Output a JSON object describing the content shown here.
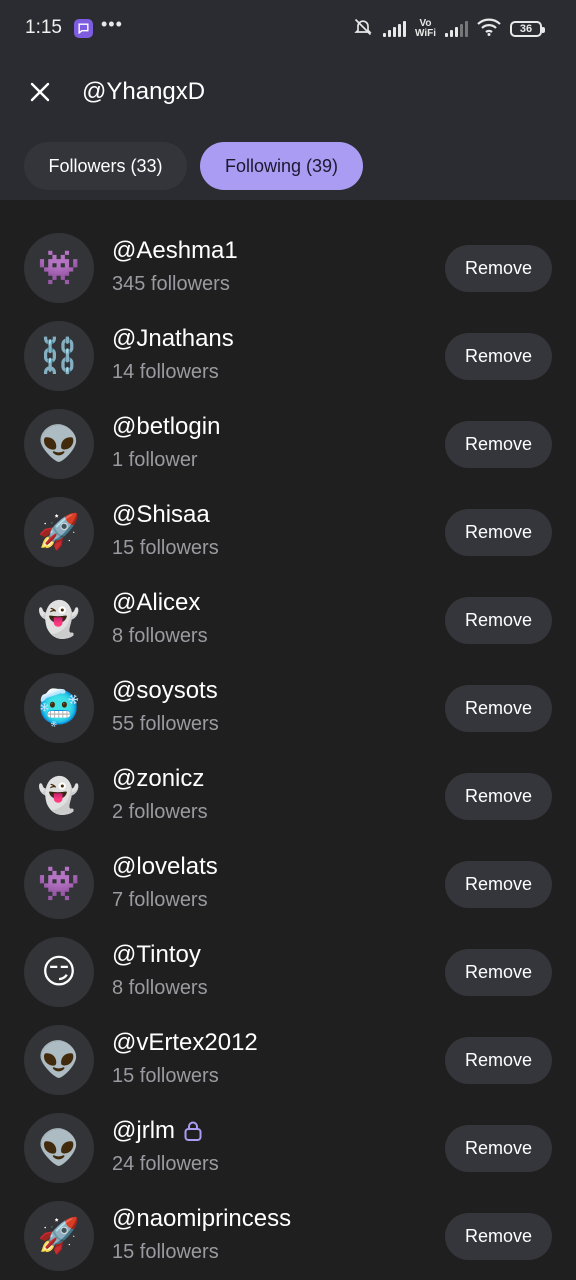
{
  "status_bar": {
    "time": "1:15",
    "battery": "36",
    "network_label_top": "Vo",
    "network_label_bottom": "WiFi"
  },
  "header": {
    "title": "@YhangxD"
  },
  "tabs": [
    {
      "label": "Followers (33)",
      "active": false
    },
    {
      "label": "Following (39)",
      "active": true
    }
  ],
  "colors": {
    "accent": "#a99cf2",
    "background": "#1f1f1f",
    "header_background": "#2b2c31"
  },
  "remove_label": "Remove",
  "users": [
    {
      "username": "@Aeshma1",
      "followers": "345 followers",
      "avatar": "👾",
      "avatar_icon": "alien-monster-icon",
      "locked": false
    },
    {
      "username": "@Jnathans",
      "followers": "14 followers",
      "avatar": "⛓️",
      "avatar_icon": "chains-icon",
      "locked": false
    },
    {
      "username": "@betlogin",
      "followers": "1 follower",
      "avatar": "👽",
      "avatar_icon": "alien-icon",
      "locked": false
    },
    {
      "username": "@Shisaa",
      "followers": "15 followers",
      "avatar": "🚀",
      "avatar_icon": "rocket-icon",
      "locked": false
    },
    {
      "username": "@Alicex",
      "followers": "8 followers",
      "avatar": "👻",
      "avatar_icon": "ghost-icon",
      "locked": false
    },
    {
      "username": "@soysots",
      "followers": "55 followers",
      "avatar": "🥶",
      "avatar_icon": "cold-face-icon",
      "locked": false
    },
    {
      "username": "@zonicz",
      "followers": "2 followers",
      "avatar": "👻",
      "avatar_icon": "ghost-icon",
      "locked": false
    },
    {
      "username": "@lovelats",
      "followers": "7 followers",
      "avatar": "👾",
      "avatar_icon": "alien-monster-icon",
      "locked": false
    },
    {
      "username": "@Tintoy",
      "followers": "8 followers",
      "avatar": "😏",
      "avatar_icon": "smirk-face-icon",
      "locked": false
    },
    {
      "username": "@vErtex2012",
      "followers": "15 followers",
      "avatar": "👽",
      "avatar_icon": "alien-icon",
      "locked": false
    },
    {
      "username": "@jrlm",
      "followers": "24 followers",
      "avatar": "👽",
      "avatar_icon": "alien-icon",
      "locked": true
    },
    {
      "username": "@naomiprincess",
      "followers": "15 followers",
      "avatar": "🚀",
      "avatar_icon": "rocket-icon",
      "locked": false
    }
  ]
}
